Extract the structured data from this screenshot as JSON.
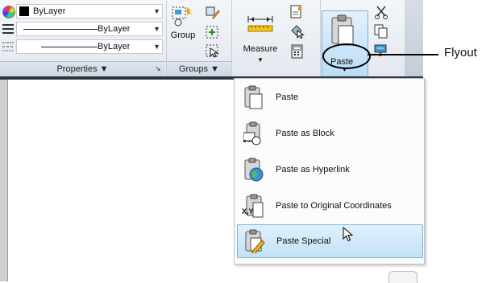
{
  "ribbon": {
    "properties": {
      "color_value": "ByLayer",
      "linetype_value": "ByLayer",
      "lineweight_value": "ByLayer",
      "panel_label": "Properties ▼"
    },
    "groups": {
      "group_button": "Group",
      "panel_label": "Groups ▼"
    },
    "utilities": {
      "measure_button": "Measure"
    },
    "clipboard": {
      "paste_button": "Paste"
    }
  },
  "flyout_menu": {
    "items": [
      {
        "label": "Paste"
      },
      {
        "label": "Paste as Block"
      },
      {
        "label": "Paste as Hyperlink"
      },
      {
        "label": "Paste to Original Coordinates"
      },
      {
        "label": "Paste Special"
      }
    ]
  },
  "callout": {
    "label": "Flyout"
  },
  "icons": {
    "xy_text": "X,Y"
  }
}
